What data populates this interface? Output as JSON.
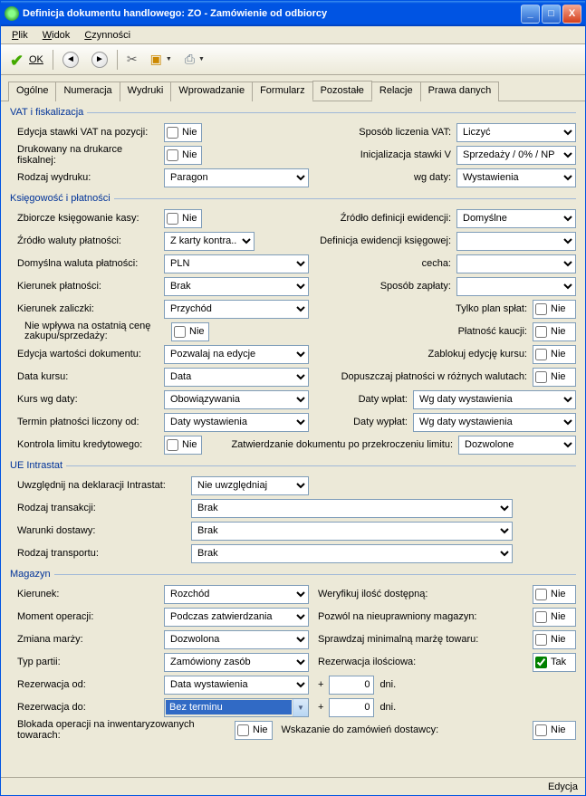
{
  "title": "Definicja dokumentu handlowego: ZO - Zamówienie od odbiorcy",
  "menu": {
    "plik": "Plik",
    "widok": "Widok",
    "czynnosci": "Czynności"
  },
  "toolbar": {
    "ok": "OK"
  },
  "tabs": [
    "Ogólne",
    "Numeracja",
    "Wydruki",
    "Wprowadzanie",
    "Formularz",
    "Pozostałe",
    "Relacje",
    "Prawa danych"
  ],
  "sections": {
    "vat": {
      "legend": "VAT i fiskalizacja",
      "edycja_stawki_lbl": "Edycja stawki VAT na pozycji:",
      "edycja_stawki_val": "Nie",
      "drukowany_lbl": "Drukowany na drukarce fiskalnej:",
      "drukowany_val": "Nie",
      "rodzaj_wydruku_lbl": "Rodzaj wydruku:",
      "rodzaj_wydruku_val": "Paragon",
      "sposob_licz_lbl": "Sposób liczenia VAT:",
      "sposob_licz_val": "Liczyć",
      "inicj_lbl": "Inicjalizacja stawki V",
      "inicj_val": "Sprzedaży / 0% / NP",
      "wg_daty_lbl": "wg daty:",
      "wg_daty_val": "Wystawienia"
    },
    "ksieg": {
      "legend": "Księgowość i płatności",
      "zbiorcze_lbl": "Zbiorcze księgowanie kasy:",
      "zbiorcze_val": "Nie",
      "zrodlo_def_lbl": "Źródło definicji ewidencji:",
      "zrodlo_def_val": "Domyślne",
      "zrodlo_wal_lbl": "Źródło waluty płatności:",
      "zrodlo_wal_val": "Z karty kontra...",
      "def_ewid_lbl": "Definicja ewidencji księgowej:",
      "def_ewid_val": "",
      "dom_wal_lbl": "Domyślna waluta płatności:",
      "dom_wal_val": "PLN",
      "cecha_lbl": "cecha:",
      "cecha_val": "",
      "kier_plat_lbl": "Kierunek płatności:",
      "kier_plat_val": "Brak",
      "sposob_zap_lbl": "Sposób zapłaty:",
      "sposob_zap_val": "",
      "kier_zal_lbl": "Kierunek zaliczki:",
      "kier_zal_val": "Przychód",
      "tylko_plan_lbl": "Tylko plan spłat:",
      "tylko_plan_val": "Nie",
      "nie_wplywa_lbl": "Nie wpływa na ostatnią cenę zakupu/sprzedaży:",
      "nie_wplywa_val": "Nie",
      "plat_kaucji_lbl": "Płatność kaucji:",
      "plat_kaucji_val": "Nie",
      "edycja_wart_lbl": "Edycja wartości dokumentu:",
      "edycja_wart_val": "Pozwalaj na edycje",
      "zablokuj_lbl": "Zablokuj edycję kursu:",
      "zablokuj_val": "Nie",
      "data_kursu_lbl": "Data kursu:",
      "data_kursu_val": "Data",
      "dopuszczaj_lbl": "Dopuszczaj płatności w różnych walutach:",
      "dopuszczaj_val": "Nie",
      "kurs_wg_lbl": "Kurs wg daty:",
      "kurs_wg_val": "Obowiązywania",
      "daty_wplat_lbl": "Daty wpłat:",
      "daty_wplat_val": "Wg daty wystawienia",
      "termin_lbl": "Termin płatności liczony od:",
      "termin_val": "Daty wystawienia",
      "daty_wyplat_lbl": "Daty wypłat:",
      "daty_wyplat_val": "Wg daty wystawienia",
      "kontrola_lbl": "Kontrola limitu kredytowego:",
      "kontrola_val": "Nie",
      "zatw_lbl": "Zatwierdzanie dokumentu po przekroczeniu limitu:",
      "zatw_val": "Dozwolone"
    },
    "ue": {
      "legend": "UE Intrastat",
      "uwzgl_lbl": "Uwzględnij na deklaracji Intrastat:",
      "uwzgl_val": "Nie uwzględniaj",
      "rodzaj_tr_lbl": "Rodzaj transakcji:",
      "rodzaj_tr_val": "Brak",
      "warunki_lbl": "Warunki dostawy:",
      "warunki_val": "Brak",
      "rodzaj_trans_lbl": "Rodzaj transportu:",
      "rodzaj_trans_val": "Brak"
    },
    "mag": {
      "legend": "Magazyn",
      "kierunek_lbl": "Kierunek:",
      "kierunek_val": "Rozchód",
      "weryf_lbl": "Weryfikuj ilość dostępną:",
      "weryf_val": "Nie",
      "moment_lbl": "Moment operacji:",
      "moment_val": "Podczas zatwierdzania",
      "pozwol_lbl": "Pozwól na nieuprawniony magazyn:",
      "pozwol_val": "Nie",
      "zmiana_lbl": "Zmiana marży:",
      "zmiana_val": "Dozwolona",
      "sprawdz_lbl": "Sprawdzaj minimalną marżę towaru:",
      "sprawdz_val": "Nie",
      "typ_partii_lbl": "Typ partii:",
      "typ_partii_val": "Zamówiony zasób",
      "rezerw_il_lbl": "Rezerwacja ilościowa:",
      "rezerw_il_val": "Tak",
      "rezerw_od_lbl": "Rezerwacja od:",
      "rezerw_od_val": "Data wystawienia",
      "plus1": "+",
      "dni1": "dni.",
      "val1": "0",
      "rezerw_do_lbl": "Rezerwacja do:",
      "rezerw_do_val": "Bez terminu",
      "plus2": "+",
      "dni2": "dni.",
      "val2": "0",
      "blokada_lbl": "Blokada operacji na inwentaryzowanych towarach:",
      "blokada_val": "Nie",
      "wskazanie_lbl": "Wskazanie do zamówień dostawcy:",
      "wskazanie_val": "Nie"
    }
  },
  "status": "Edycja"
}
